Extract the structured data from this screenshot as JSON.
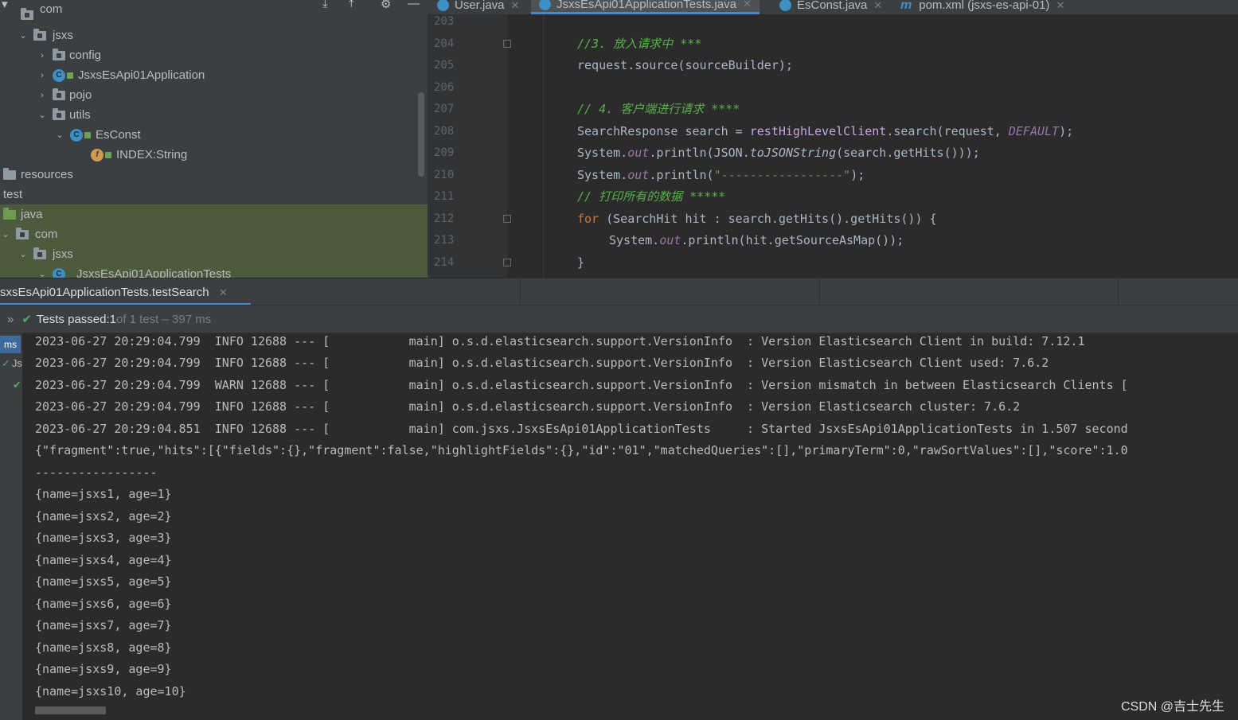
{
  "project_tree": {
    "items": [
      {
        "label": "com",
        "arrow": "⌄",
        "icon": "folder"
      },
      {
        "label": "jsxs",
        "arrow": "⌄",
        "icon": "folder"
      },
      {
        "label": "config",
        "arrow": "›",
        "icon": "folder"
      },
      {
        "label": "JsxsEsApi01Application",
        "arrow": "›",
        "icon": "spring-class"
      },
      {
        "label": "pojo",
        "arrow": "›",
        "icon": "folder"
      },
      {
        "label": "utils",
        "arrow": "⌄",
        "icon": "folder"
      },
      {
        "label": "EsConst",
        "arrow": "⌄",
        "icon": "class"
      },
      {
        "label": "INDEX:String",
        "arrow": "",
        "icon": "field"
      },
      {
        "label": "resources",
        "arrow": "",
        "icon": "resources-folder"
      },
      {
        "label": "test",
        "arrow": "",
        "icon": "none"
      },
      {
        "label": "java",
        "arrow": "",
        "icon": "test-folder"
      },
      {
        "label": "com",
        "arrow": "⌄",
        "icon": "folder"
      },
      {
        "label": "jsxs",
        "arrow": "⌄",
        "icon": "folder"
      },
      {
        "label": "JsxsEsApi01ApplicationTests",
        "arrow": "⌄",
        "icon": "class"
      }
    ]
  },
  "editor": {
    "tabs": [
      {
        "label": "User.java",
        "icon": "class-icon",
        "active": false
      },
      {
        "label": "JsxsEsApi01ApplicationTests.java",
        "icon": "class-icon",
        "active": true
      },
      {
        "label": "EsConst.java",
        "icon": "class-icon",
        "active": false
      },
      {
        "label": "pom.xml (jsxs-es-api-01)",
        "icon": "maven-icon",
        "active": false
      }
    ],
    "line_numbers": [
      "203",
      "204",
      "205",
      "206",
      "207",
      "208",
      "209",
      "210",
      "211",
      "212",
      "213",
      "214"
    ],
    "code": {
      "l204": "//3. 放入请求中 ***",
      "l205": "request.source(sourceBuilder);",
      "l207": "// 4. 客户端进行请求 ****",
      "l208_a": "SearchResponse search = ",
      "l208_b": "restHighLevelClient",
      "l208_c": ".search(request, ",
      "l208_d": "DEFAULT",
      "l208_e": ");",
      "l209_a": "System.",
      "l209_b": "out",
      "l209_c": ".println(JSON.",
      "l209_d": "toJSONString",
      "l209_e": "(search.getHits()));",
      "l210_a": "System.",
      "l210_b": "out",
      "l210_c": ".println(",
      "l210_d": "\"-----------------\"",
      "l210_e": ");",
      "l211": "// 打印所有的数据 *****",
      "l212_a": "for",
      "l212_b": " (SearchHit hit : search.getHits().getHits()) {",
      "l213_a": "System.",
      "l213_b": "out",
      "l213_c": ".println(hit.getSourceAsMap());",
      "l214": "}"
    }
  },
  "run_panel": {
    "tab_label": "sxsEsApi01ApplicationTests.testSearch",
    "status_passed_label": "Tests passed: ",
    "status_passed_count": "1",
    "status_suffix": " of 1 test – 397 ms",
    "side_ms": "ms",
    "side_js": "Js",
    "console_lines": [
      "2023-06-27 20:29:04.799  INFO 12688 --- [           main] o.s.d.elasticsearch.support.VersionInfo  : Version Elasticsearch Client in build: 7.12.1",
      "2023-06-27 20:29:04.799  INFO 12688 --- [           main] o.s.d.elasticsearch.support.VersionInfo  : Version Elasticsearch Client used: 7.6.2",
      "2023-06-27 20:29:04.799  WARN 12688 --- [           main] o.s.d.elasticsearch.support.VersionInfo  : Version mismatch in between Elasticsearch Clients [",
      "2023-06-27 20:29:04.799  INFO 12688 --- [           main] o.s.d.elasticsearch.support.VersionInfo  : Version Elasticsearch cluster: 7.6.2",
      "2023-06-27 20:29:04.851  INFO 12688 --- [           main] com.jsxs.JsxsEsApi01ApplicationTests     : Started JsxsEsApi01ApplicationTests in 1.507 second",
      "{\"fragment\":true,\"hits\":[{\"fields\":{},\"fragment\":false,\"highlightFields\":{},\"id\":\"01\",\"matchedQueries\":[],\"primaryTerm\":0,\"rawSortValues\":[],\"score\":1.0",
      "-----------------",
      "{name=jsxs1, age=1}",
      "{name=jsxs2, age=2}",
      "{name=jsxs3, age=3}",
      "{name=jsxs4, age=4}",
      "{name=jsxs5, age=5}",
      "{name=jsxs6, age=6}",
      "{name=jsxs7, age=7}",
      "{name=jsxs8, age=8}",
      "{name=jsxs9, age=9}",
      "{name=jsxs10, age=10}"
    ]
  },
  "watermark": "CSDN @吉士先生",
  "colors": {
    "background": "#2b2b2b",
    "panel": "#3c3f41",
    "accent": "#4a88c7",
    "comment": "#58b04a",
    "keyword": "#cc7832",
    "field": "#9876aa",
    "string": "#6a8759",
    "success": "#59a869"
  }
}
